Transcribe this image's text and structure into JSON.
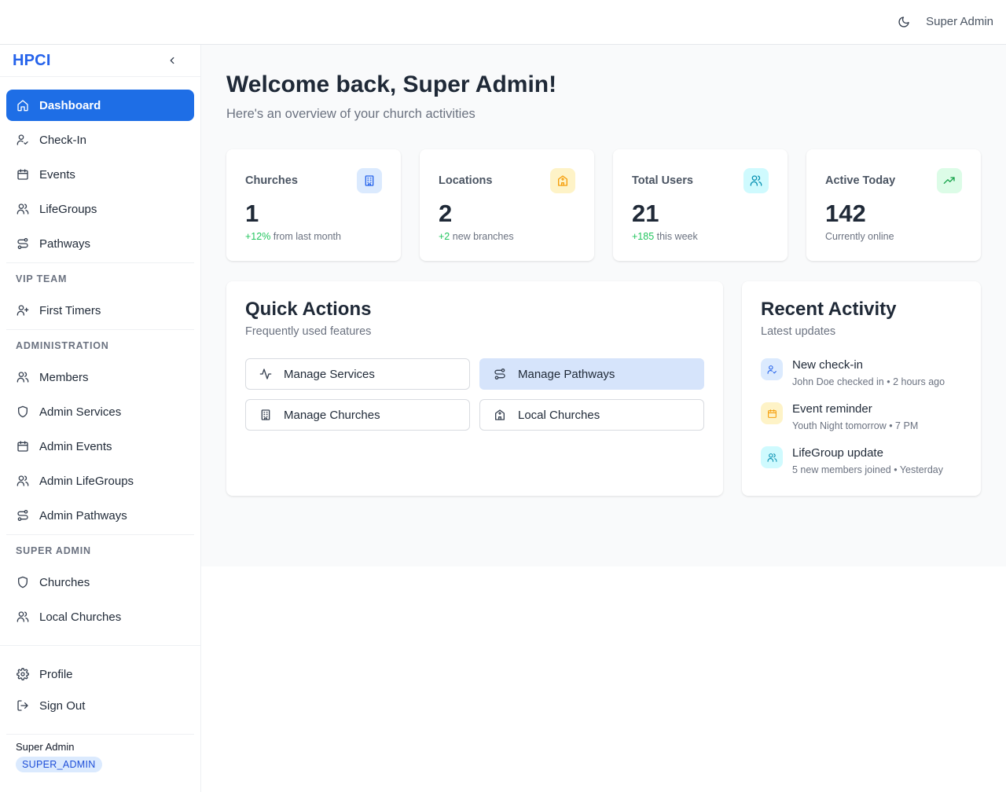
{
  "topbar": {
    "theme_icon": "moon-icon",
    "user_name": "Super Admin"
  },
  "sidebar": {
    "brand": "HPCI",
    "collapse_icon": "chevron-left-icon",
    "main_items": [
      {
        "label": "Dashboard",
        "icon": "home-icon",
        "active": true
      },
      {
        "label": "Check-In",
        "icon": "user-check-icon"
      },
      {
        "label": "Events",
        "icon": "calendar-icon"
      },
      {
        "label": "LifeGroups",
        "icon": "users-icon"
      },
      {
        "label": "Pathways",
        "icon": "route-icon"
      }
    ],
    "vip_section": "VIP TEAM",
    "vip_items": [
      {
        "label": "First Timers",
        "icon": "user-plus-icon"
      }
    ],
    "admin_section": "ADMINISTRATION",
    "admin_items": [
      {
        "label": "Members",
        "icon": "users-icon"
      },
      {
        "label": "Admin Services",
        "icon": "shield-icon"
      },
      {
        "label": "Admin Events",
        "icon": "calendar-icon"
      },
      {
        "label": "Admin LifeGroups",
        "icon": "users-icon"
      },
      {
        "label": "Admin Pathways",
        "icon": "route-icon"
      }
    ],
    "super_section": "SUPER ADMIN",
    "super_items": [
      {
        "label": "Churches",
        "icon": "shield-icon"
      },
      {
        "label": "Local Churches",
        "icon": "users-icon"
      }
    ],
    "footer_items": [
      {
        "label": "Profile",
        "icon": "gear-icon"
      },
      {
        "label": "Sign Out",
        "icon": "sign-out-icon"
      }
    ],
    "user_name": "Super Admin",
    "user_role": "SUPER_ADMIN"
  },
  "main": {
    "title": "Welcome back, Super Admin!",
    "subtitle": "Here's an overview of your church activities",
    "stats": [
      {
        "label": "Churches",
        "value": "1",
        "delta": "+12%",
        "note": " from last month",
        "icon": "building-icon",
        "color": "#2563eb",
        "bg": "#dbeafe"
      },
      {
        "label": "Locations",
        "value": "2",
        "delta": "+2",
        "note": " new branches",
        "icon": "church-icon",
        "color": "#f59e0b",
        "bg": "#fef3c7"
      },
      {
        "label": "Total Users",
        "value": "21",
        "delta": "+185",
        "note": " this week",
        "icon": "users-icon",
        "color": "#0891b2",
        "bg": "#cffafe"
      },
      {
        "label": "Active Today",
        "value": "142",
        "delta": "",
        "note": "Currently online",
        "icon": "trending-up-icon",
        "color": "#16a34a",
        "bg": "#dcfce7"
      }
    ],
    "quick_actions": {
      "title": "Quick Actions",
      "subtitle": "Frequently used features",
      "buttons": [
        {
          "label": "Manage Services",
          "icon": "activity-icon"
        },
        {
          "label": "Manage Pathways",
          "icon": "route-icon"
        },
        {
          "label": "Manage Churches",
          "icon": "building-icon"
        },
        {
          "label": "Local Churches",
          "icon": "church-icon"
        }
      ]
    },
    "recent_activity": {
      "title": "Recent Activity",
      "subtitle": "Latest updates",
      "items": [
        {
          "title": "New check-in",
          "desc": "John Doe checked in • 2 hours ago",
          "icon": "user-check-icon",
          "color": "#2563eb",
          "bg": "#dbeafe"
        },
        {
          "title": "Event reminder",
          "desc": "Youth Night tomorrow • 7 PM",
          "icon": "calendar-icon",
          "color": "#f59e0b",
          "bg": "#fef3c7"
        },
        {
          "title": "LifeGroup update",
          "desc": "5 new members joined • Yesterday",
          "icon": "users-icon",
          "color": "#0891b2",
          "bg": "#cffafe"
        }
      ]
    }
  }
}
